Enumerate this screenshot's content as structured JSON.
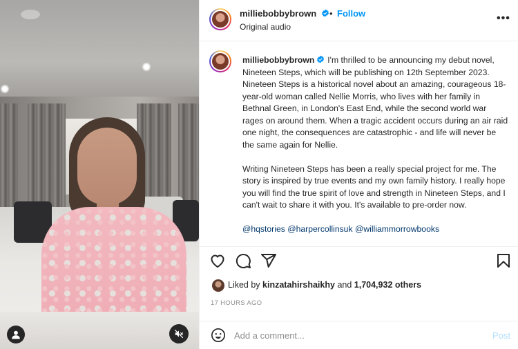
{
  "header": {
    "username": "milliebobbybrown",
    "separator": "•",
    "follow_label": "Follow",
    "audio_label": "Original audio",
    "more_label": "•••"
  },
  "caption": {
    "username": "milliebobbybrown",
    "paragraph1": "I'm thrilled to be announcing my debut novel, Nineteen Steps, which will be publishing on 12th September 2023. Nineteen Steps is a historical novel about an amazing, courageous 18-year-old woman called Nellie Morris, who lives with her family in Bethnal Green, in London's East End, while the second world war rages on around them. When a tragic accident occurs during an air raid one night, the consequences are catastrophic - and life will never be the same again for Nellie.",
    "paragraph2": "Writing Nineteen Steps has been a really special project for me. The story is inspired by true events and my own family history. I really hope you will find the true spirit of love and strength in Nineteen Steps, and I can't wait to share it with you. It's available to pre-order now.",
    "mentions": [
      "@hqstories",
      "@harpercollinsuk",
      "@williammorrowbooks"
    ]
  },
  "likes": {
    "prefix": "Liked by",
    "user": "kinzatahirshaikhy",
    "conjunction": "and",
    "others": "1,704,932 others"
  },
  "timestamp": "17 HOURS AGO",
  "comment": {
    "placeholder": "Add a comment...",
    "post_label": "Post"
  },
  "colors": {
    "accent": "#0095f6",
    "link": "#00376b",
    "muted": "#8e8e8e",
    "post_disabled": "#b2dffc"
  },
  "icons": {
    "action_bar": [
      "heart-icon",
      "comment-icon",
      "share-icon",
      "bookmark-icon"
    ],
    "media": [
      "user-tag-icon",
      "mute-icon"
    ],
    "verified": "verified-badge-icon",
    "emoji": "emoji-icon"
  }
}
